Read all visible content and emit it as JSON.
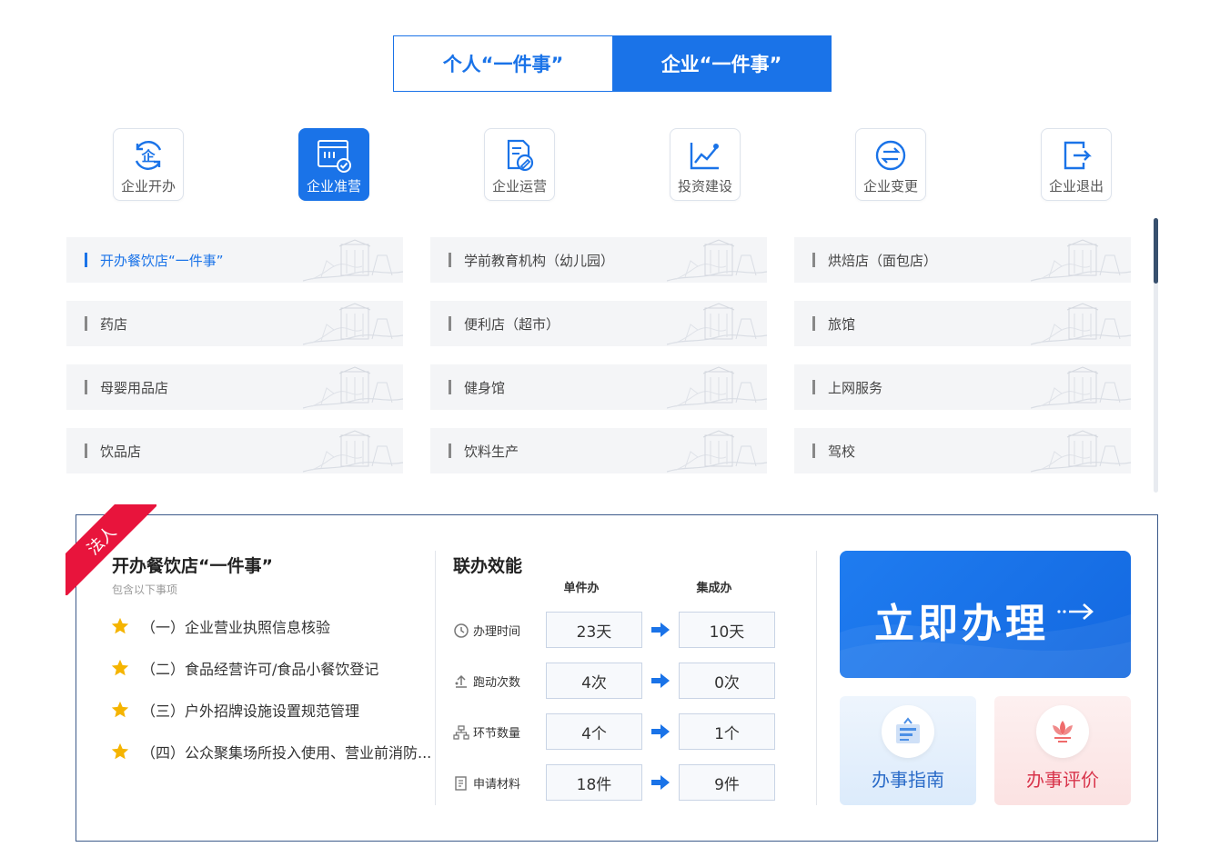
{
  "tabs": [
    {
      "label": "个人“一件事”",
      "active": false
    },
    {
      "label": "企业“一件事”",
      "active": true
    }
  ],
  "categories": [
    {
      "label": "企业开办",
      "icon": "enterprise-start-icon",
      "active": false
    },
    {
      "label": "企业准营",
      "icon": "enterprise-permit-icon",
      "active": true
    },
    {
      "label": "企业运营",
      "icon": "enterprise-operation-icon",
      "active": false
    },
    {
      "label": "投资建设",
      "icon": "investment-chart-icon",
      "active": false
    },
    {
      "label": "企业变更",
      "icon": "exchange-icon",
      "active": false
    },
    {
      "label": "企业退出",
      "icon": "exit-icon",
      "active": false
    }
  ],
  "items": [
    "开办餐饮店“一件事”",
    "学前教育机构（幼儿园）",
    "烘焙店（面包店）",
    "药店",
    "便利店（超市）",
    "旅馆",
    "母婴用品店",
    "健身馆",
    "上网服务",
    "饮品店",
    "饮料生产",
    "驾校"
  ],
  "active_item": 0,
  "detail": {
    "ribbon": "法人",
    "title": "开办餐饮店“一件事”",
    "subtitle": "包含以下事项",
    "sub_items": [
      "（一）企业营业执照信息核验",
      "（二）食品经营许可/食品小餐饮登记",
      "（三）户外招牌设施设置规范管理",
      "（四）公众聚集场所投入使用、营业前消防..."
    ],
    "efficiency": {
      "title": "联办效能",
      "col_single": "单件办",
      "col_integrated": "集成办",
      "rows": [
        {
          "label": "办理时间",
          "icon": "clock-icon",
          "single": "23天",
          "integrated": "10天"
        },
        {
          "label": "跑动次数",
          "icon": "running-icon",
          "single": "4次",
          "integrated": "0次"
        },
        {
          "label": "环节数量",
          "icon": "flow-icon",
          "single": "4个",
          "integrated": "1个"
        },
        {
          "label": "申请材料",
          "icon": "document-icon",
          "single": "18件",
          "integrated": "9件"
        }
      ]
    },
    "apply_button": "立即办理",
    "guide_label": "办事指南",
    "rate_label": "办事评价"
  },
  "colors": {
    "primary": "#1a73e8",
    "ribbon": "#e8143c",
    "star": "#f5b400",
    "rate": "#d8334a"
  }
}
